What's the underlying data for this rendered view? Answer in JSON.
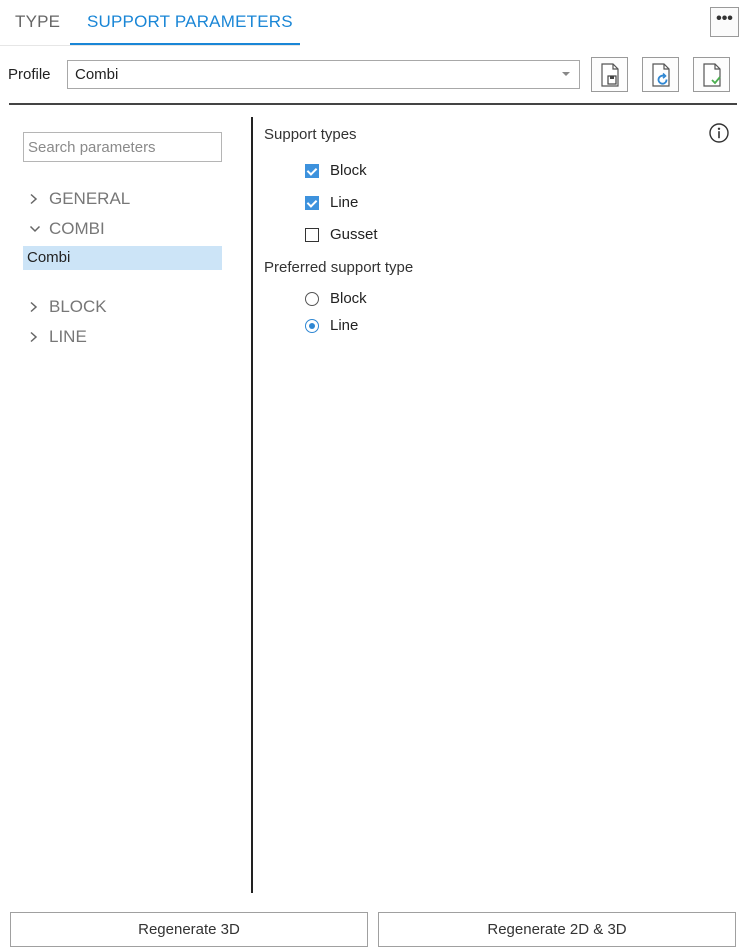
{
  "tabs": [
    {
      "label": "TYPE",
      "active": false
    },
    {
      "label": "SUPPORT PARAMETERS",
      "active": true
    }
  ],
  "more_button": {
    "label": "•••",
    "icon": "ellipsis-icon"
  },
  "profile": {
    "label": "Profile",
    "value": "Combi",
    "buttons": [
      {
        "icon": "file-save-icon"
      },
      {
        "icon": "file-refresh-icon"
      },
      {
        "icon": "file-check-icon"
      }
    ]
  },
  "search": {
    "placeholder": "Search parameters",
    "value": ""
  },
  "tree": [
    {
      "label": "GENERAL",
      "expanded": false
    },
    {
      "label": "COMBI",
      "expanded": true,
      "children": [
        {
          "label": "Combi",
          "selected": true
        }
      ]
    },
    {
      "label": "BLOCK",
      "expanded": false
    },
    {
      "label": "LINE",
      "expanded": false
    }
  ],
  "support_types": {
    "label": "Support types",
    "options": [
      {
        "label": "Block",
        "checked": true
      },
      {
        "label": "Line",
        "checked": true
      },
      {
        "label": "Gusset",
        "checked": false
      }
    ]
  },
  "preferred_support_type": {
    "label": "Preferred support type",
    "options": [
      {
        "label": "Block",
        "selected": false
      },
      {
        "label": "Line",
        "selected": true
      }
    ]
  },
  "info_icon": "info-icon",
  "buttons": {
    "regenerate_3d": "Regenerate 3D",
    "regenerate_2d_3d": "Regenerate 2D & 3D"
  },
  "colors": {
    "accent": "#1a86d6",
    "checkbox": "#3d92dd",
    "selection": "#cce4f7"
  }
}
